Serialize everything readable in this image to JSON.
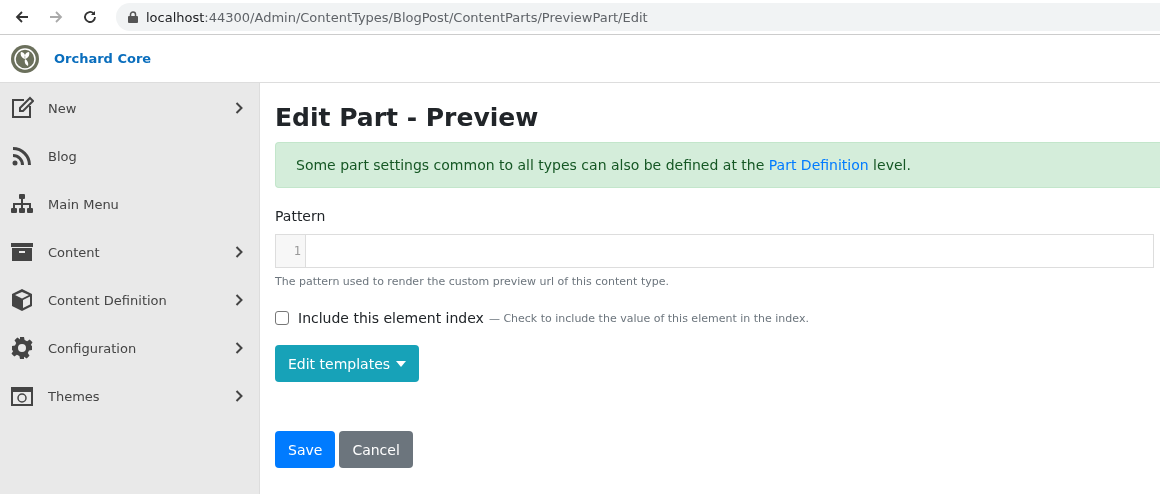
{
  "browser": {
    "url_host": "localhost",
    "url_path": ":44300/Admin/ContentTypes/BlogPost/ContentParts/PreviewPart/Edit"
  },
  "header": {
    "brand": "Orchard Core"
  },
  "sidebar": {
    "items": [
      {
        "label": "New",
        "has_submenu": true
      },
      {
        "label": "Blog",
        "has_submenu": false
      },
      {
        "label": "Main Menu",
        "has_submenu": false
      },
      {
        "label": "Content",
        "has_submenu": true
      },
      {
        "label": "Content Definition",
        "has_submenu": true
      },
      {
        "label": "Configuration",
        "has_submenu": true
      },
      {
        "label": "Themes",
        "has_submenu": true
      }
    ]
  },
  "page": {
    "title": "Edit Part - Preview",
    "alert": {
      "before": "Some part settings common to all types can also be defined at the",
      "link": "Part Definition",
      "after": "level."
    },
    "pattern": {
      "label": "Pattern",
      "line_number": "1",
      "hint": "The pattern used to render the custom preview url of this content type."
    },
    "include_index": {
      "label": "Include this element index",
      "hint": "— Check to include the value of this element in the index.",
      "checked": false
    },
    "templates_button": "Edit templates",
    "buttons": [
      "Save",
      "Cancel"
    ]
  }
}
